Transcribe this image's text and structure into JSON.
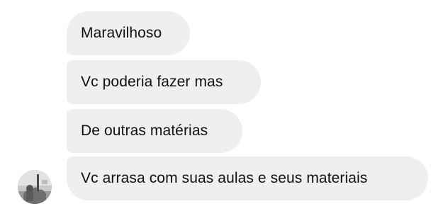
{
  "conversation": {
    "messages": [
      {
        "text": "Maravilhoso"
      },
      {
        "text": "Vc poderia fazer mas"
      },
      {
        "text": "De outras matérias"
      },
      {
        "text": "Vc arrasa com suas aulas e seus materiais"
      }
    ],
    "sender": {
      "avatar_icon": "user-photo-avatar"
    }
  },
  "colors": {
    "bubble_background": "#efefef",
    "text": "#111111",
    "page_background": "#ffffff"
  }
}
